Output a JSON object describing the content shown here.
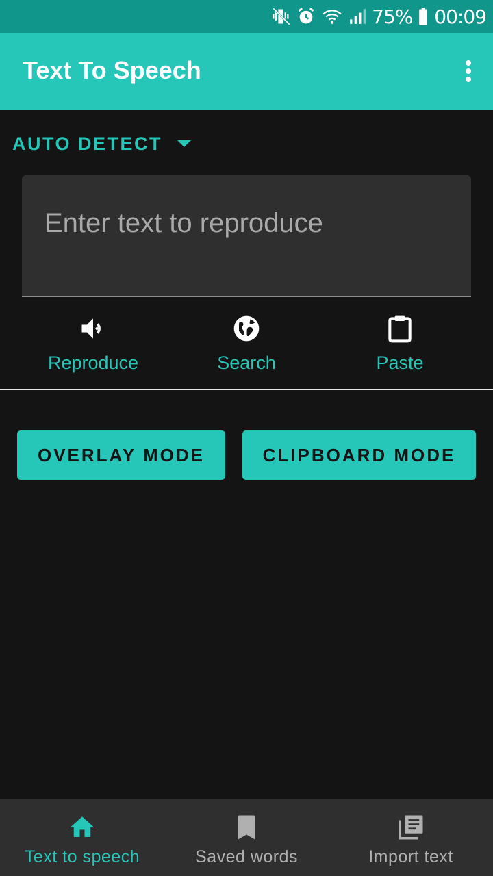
{
  "status_bar": {
    "battery_percent": "75%",
    "time": "00:09",
    "icons": [
      "vibrate-off-icon",
      "alarm-icon",
      "wifi-icon",
      "signal-icon",
      "battery-icon"
    ]
  },
  "app_bar": {
    "title": "Text To Speech",
    "menu_icon": "more-vert-icon"
  },
  "language": {
    "selected": "AUTO DETECT"
  },
  "input": {
    "placeholder": "Enter text to reproduce",
    "value": ""
  },
  "actions": [
    {
      "label": "Reproduce",
      "icon": "volume-icon"
    },
    {
      "label": "Search",
      "icon": "globe-icon"
    },
    {
      "label": "Paste",
      "icon": "clipboard-icon"
    }
  ],
  "modes": {
    "overlay_label": "OVERLAY MODE",
    "clipboard_label": "CLIPBOARD MODE"
  },
  "bottom_nav": [
    {
      "label": "Text to speech",
      "icon": "home-icon",
      "active": true
    },
    {
      "label": "Saved words",
      "icon": "bookmark-icon",
      "active": false
    },
    {
      "label": "Import text",
      "icon": "library-books-icon",
      "active": false
    }
  ],
  "colors": {
    "accent": "#26c6b9",
    "status_bar": "#10968a",
    "background": "#141414",
    "surface": "#2f2f2f"
  }
}
